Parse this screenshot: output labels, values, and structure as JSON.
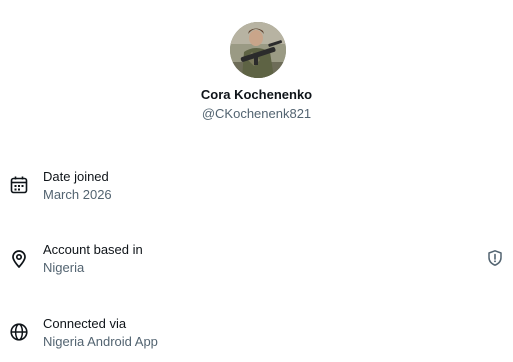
{
  "profile": {
    "display_name": "Cora Kochenenko",
    "handle": "@CKochenenk821",
    "avatar_icon": "profile-photo"
  },
  "rows": [
    {
      "icon": "calendar-icon",
      "title": "Date joined",
      "value": "March 2026"
    },
    {
      "icon": "location-pin-icon",
      "title": "Account based in",
      "value": "Nigeria",
      "trailing_icon": "shield-info-icon"
    },
    {
      "icon": "globe-icon",
      "title": "Connected via",
      "value": "Nigeria Android App"
    }
  ],
  "colors": {
    "primary_text": "#0f1419",
    "secondary_text": "#536471"
  }
}
